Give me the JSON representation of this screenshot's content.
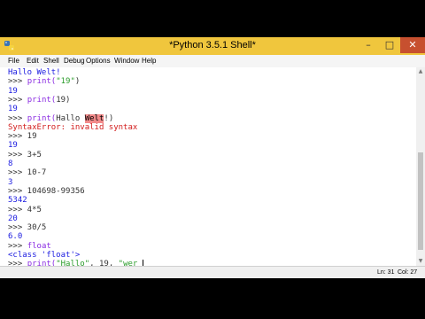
{
  "window": {
    "title": "*Python 3.5.1 Shell*",
    "controls": {
      "minimize": "–",
      "maximize": "□",
      "close": "✕"
    },
    "titlebar_color": "#f0c63d"
  },
  "menu": [
    "File",
    "Edit",
    "Shell",
    "Debug",
    "Options",
    "Window",
    "Help"
  ],
  "shell": {
    "lines": [
      {
        "segments": [
          {
            "text": "Hallo Welt!",
            "cls": "c-out"
          }
        ]
      },
      {
        "segments": [
          {
            "text": ">>> ",
            "cls": "c-prompt"
          },
          {
            "text": "print(",
            "cls": "c-kw"
          },
          {
            "text": "\"19\"",
            "cls": "c-str"
          },
          {
            "text": ")",
            "cls": "c-prompt"
          }
        ]
      },
      {
        "segments": [
          {
            "text": "19",
            "cls": "c-out"
          }
        ]
      },
      {
        "segments": [
          {
            "text": ">>> ",
            "cls": "c-prompt"
          },
          {
            "text": "print(",
            "cls": "c-kw"
          },
          {
            "text": "19)",
            "cls": "c-prompt"
          }
        ]
      },
      {
        "segments": [
          {
            "text": "19",
            "cls": "c-out"
          }
        ]
      },
      {
        "segments": [
          {
            "text": ">>> ",
            "cls": "c-prompt"
          },
          {
            "text": "print(",
            "cls": "c-kw"
          },
          {
            "text": "Hallo ",
            "cls": "c-prompt"
          },
          {
            "text": "Welt",
            "cls": "hl-err"
          },
          {
            "text": "!)",
            "cls": "c-prompt"
          }
        ]
      },
      {
        "segments": [
          {
            "text": "SyntaxError: invalid syntax",
            "cls": "c-err"
          }
        ]
      },
      {
        "segments": [
          {
            "text": ">>> 19",
            "cls": "c-prompt"
          }
        ]
      },
      {
        "segments": [
          {
            "text": "19",
            "cls": "c-out"
          }
        ]
      },
      {
        "segments": [
          {
            "text": ">>> 3+5",
            "cls": "c-prompt"
          }
        ]
      },
      {
        "segments": [
          {
            "text": "8",
            "cls": "c-out"
          }
        ]
      },
      {
        "segments": [
          {
            "text": ">>> 10-7",
            "cls": "c-prompt"
          }
        ]
      },
      {
        "segments": [
          {
            "text": "3",
            "cls": "c-out"
          }
        ]
      },
      {
        "segments": [
          {
            "text": ">>> 104698-99356",
            "cls": "c-prompt"
          }
        ]
      },
      {
        "segments": [
          {
            "text": "5342",
            "cls": "c-out"
          }
        ]
      },
      {
        "segments": [
          {
            "text": ">>> 4*5",
            "cls": "c-prompt"
          }
        ]
      },
      {
        "segments": [
          {
            "text": "20",
            "cls": "c-out"
          }
        ]
      },
      {
        "segments": [
          {
            "text": ">>> 30/5",
            "cls": "c-prompt"
          }
        ]
      },
      {
        "segments": [
          {
            "text": "6.0",
            "cls": "c-out"
          }
        ]
      },
      {
        "segments": [
          {
            "text": ">>> ",
            "cls": "c-prompt"
          },
          {
            "text": "float",
            "cls": "c-kw"
          }
        ]
      },
      {
        "segments": [
          {
            "text": "<class 'float'>",
            "cls": "c-out"
          }
        ]
      },
      {
        "segments": [
          {
            "text": ">>> ",
            "cls": "c-prompt"
          },
          {
            "text": "print(",
            "cls": "c-kw"
          },
          {
            "text": "\"Hallo\"",
            "cls": "c-str"
          },
          {
            "text": ", 19, ",
            "cls": "c-prompt"
          },
          {
            "text": "\"wer ",
            "cls": "c-str"
          }
        ]
      }
    ]
  },
  "status": {
    "line": "Ln: 31",
    "col": "Col: 27"
  }
}
